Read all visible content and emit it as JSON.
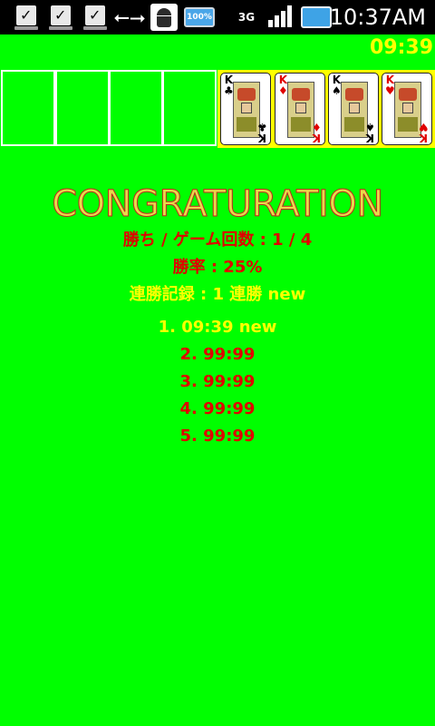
{
  "status_bar": {
    "battery_text": "100%",
    "network_label": "3G",
    "time": "10:37AM"
  },
  "game": {
    "timer": "09:39",
    "foundation_cards": [
      {
        "rank": "K",
        "suit": "♣",
        "color": "black"
      },
      {
        "rank": "K",
        "suit": "♦",
        "color": "red"
      },
      {
        "rank": "K",
        "suit": "♠",
        "color": "black"
      },
      {
        "rank": "K",
        "suit": "♥",
        "color": "red"
      }
    ]
  },
  "result": {
    "title": "CONGRATURATION",
    "win_games": "勝ち / ゲーム回数 : 1 / 4",
    "win_rate": "勝率 : 25%",
    "streak": "連勝記録 : 1 連勝 new",
    "ranking": [
      {
        "text": "1.  09:39 new",
        "highlight": true
      },
      {
        "text": "2.  99:99",
        "highlight": false
      },
      {
        "text": "3.  99:99",
        "highlight": false
      },
      {
        "text": "4.  99:99",
        "highlight": false
      },
      {
        "text": "5.  99:99",
        "highlight": false
      }
    ]
  },
  "colors": {
    "background": "#00ff00",
    "highlight": "#ffff00",
    "text_red": "#e00000"
  }
}
